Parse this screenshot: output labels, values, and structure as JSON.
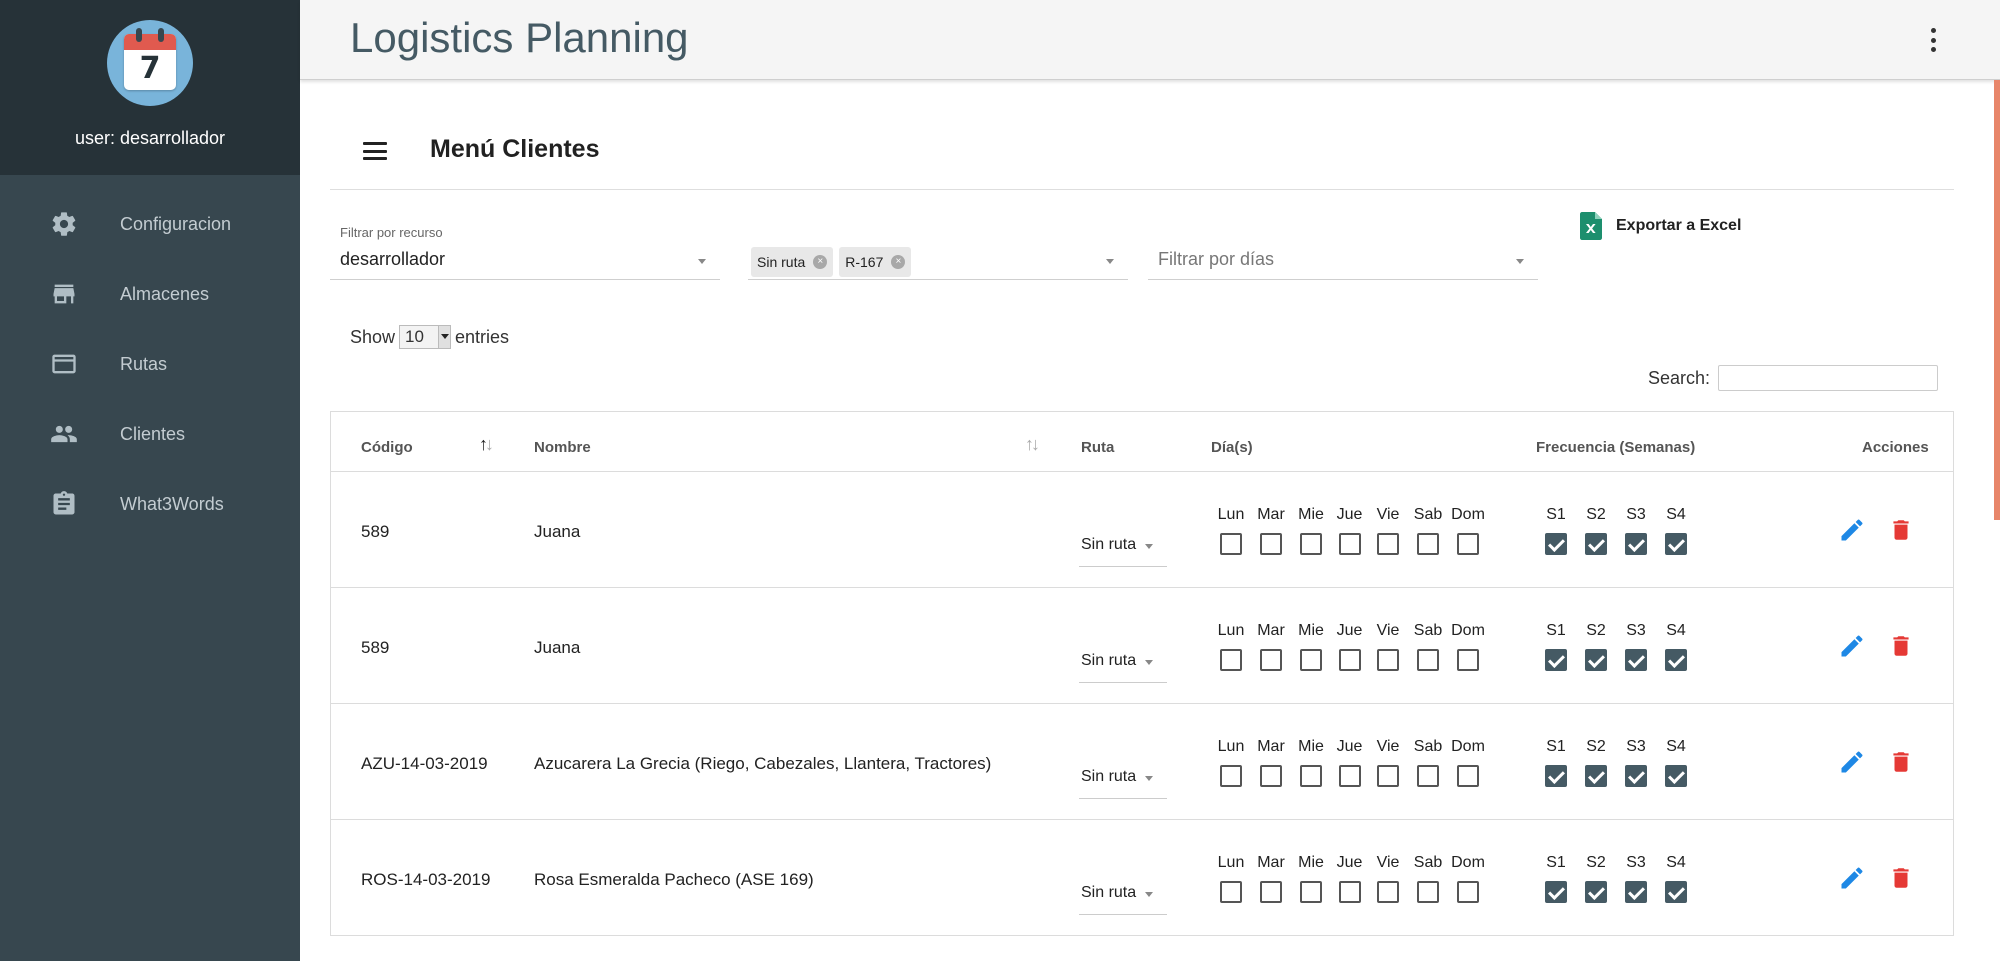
{
  "app": {
    "title": "Logistics Planning"
  },
  "sidebar": {
    "logo_number": "7",
    "user_label": "user: desarrollador",
    "items": [
      {
        "label": "Configuracion",
        "icon": "gear-icon"
      },
      {
        "label": "Almacenes",
        "icon": "store-icon"
      },
      {
        "label": "Rutas",
        "icon": "card-icon"
      },
      {
        "label": "Clientes",
        "icon": "people-icon"
      },
      {
        "label": "What3Words",
        "icon": "clipboard-icon"
      }
    ]
  },
  "panel": {
    "title": "Menú Clientes"
  },
  "filters": {
    "recurso_label": "Filtrar por recurso",
    "recurso_value": "desarrollador",
    "routes": [
      "Sin ruta",
      "R-167"
    ],
    "dias_placeholder": "Filtrar por días"
  },
  "export": {
    "label": "Exportar a Excel"
  },
  "entries": {
    "show_label": "Show",
    "value": "10",
    "entries_label": "entries"
  },
  "search": {
    "label": "Search:",
    "value": ""
  },
  "table": {
    "headers": {
      "codigo": "Código",
      "nombre": "Nombre",
      "ruta": "Ruta",
      "dias": "Día(s)",
      "frecuencia": "Frecuencia (Semanas)",
      "acciones": "Acciones"
    },
    "day_labels": [
      "Lun",
      "Mar",
      "Mie",
      "Jue",
      "Vie",
      "Sab",
      "Dom"
    ],
    "week_labels": [
      "S1",
      "S2",
      "S3",
      "S4"
    ],
    "rows": [
      {
        "codigo": "589",
        "nombre": "Juana",
        "ruta": "Sin ruta",
        "days": [
          false,
          false,
          false,
          false,
          false,
          false,
          false
        ],
        "weeks": [
          true,
          true,
          true,
          true
        ]
      },
      {
        "codigo": "589",
        "nombre": "Juana",
        "ruta": "Sin ruta",
        "days": [
          false,
          false,
          false,
          false,
          false,
          false,
          false
        ],
        "weeks": [
          true,
          true,
          true,
          true
        ]
      },
      {
        "codigo": "AZU-14-03-2019",
        "nombre": "Azucarera La Grecia (Riego, Cabezales, Llantera, Tractores)",
        "ruta": "Sin ruta",
        "days": [
          false,
          false,
          false,
          false,
          false,
          false,
          false
        ],
        "weeks": [
          true,
          true,
          true,
          true
        ]
      },
      {
        "codigo": "ROS-14-03-2019",
        "nombre": "Rosa Esmeralda Pacheco (ASE 169)",
        "ruta": "Sin ruta",
        "days": [
          false,
          false,
          false,
          false,
          false,
          false,
          false
        ],
        "weeks": [
          true,
          true,
          true,
          true
        ]
      }
    ]
  },
  "colors": {
    "sidebar": "#37474f",
    "sidebar_top": "#263238",
    "checkbox_checked": "#455a64",
    "edit": "#1e88e5",
    "delete": "#e53935",
    "excel": "#1d8f6e",
    "scroll_indicator": "#e8866a"
  }
}
